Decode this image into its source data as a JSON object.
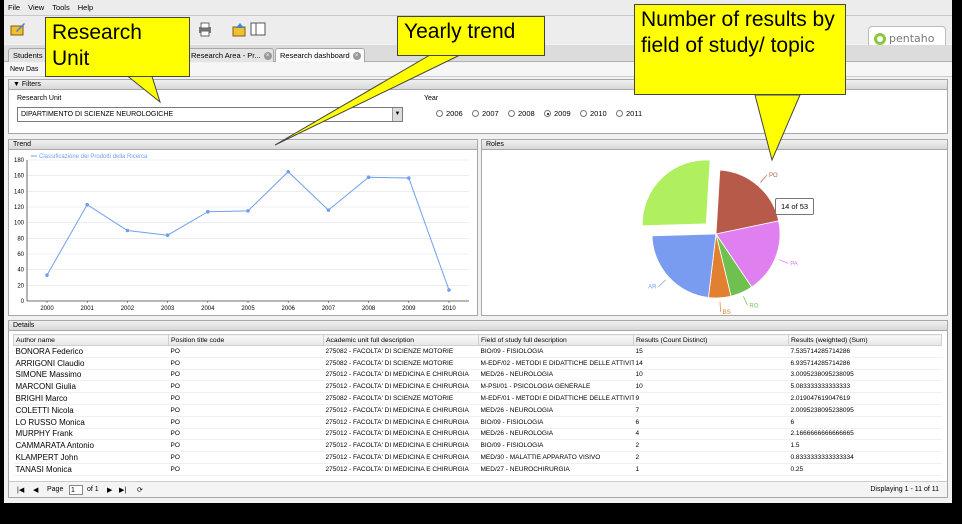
{
  "menu": {
    "items": [
      "File",
      "View",
      "Tools",
      "Help"
    ]
  },
  "logo_text": "pentaho",
  "tabs": [
    {
      "label": "Students"
    },
    {
      "label": "Research Area - Pr..."
    },
    {
      "label": "Research dashboard"
    }
  ],
  "subbar_label": "New Das",
  "filters": {
    "title": "Filters",
    "research_unit_label": "Research Unit",
    "research_unit_value": "DIPARTIMENTO DI SCIENZE NEUROLOGICHE",
    "year_label": "Year",
    "years": [
      "2006",
      "2007",
      "2008",
      "2009",
      "2010",
      "2011"
    ],
    "selected_year": "2009"
  },
  "trend_title": "Trend",
  "roles_title": "Roles",
  "details_title": "Details",
  "tooltip": "14 of 53",
  "callouts": {
    "research_unit": "Research Unit",
    "yearly_trend": "Yearly trend",
    "results_by_field": "Number of results by field of study/ topic"
  },
  "chart_data": [
    {
      "type": "line",
      "legend": "Classificazione dei Prodotti della Ricerca",
      "x": [
        "2000",
        "2001",
        "2002",
        "2003",
        "2004",
        "2005",
        "2006",
        "2007",
        "2008",
        "2009",
        "2010"
      ],
      "series": [
        {
          "name": "Classificazione dei Prodotti della Ricerca",
          "values": [
            33,
            123,
            90,
            84,
            114,
            115,
            165,
            116,
            158,
            157,
            14
          ]
        }
      ],
      "ylim": [
        0,
        180
      ],
      "yticks": [
        0,
        20,
        40,
        60,
        80,
        100,
        120,
        140,
        160,
        180
      ],
      "color": "#6f9ff0",
      "grid": true,
      "legend_position": "top-left"
    },
    {
      "type": "pie",
      "categories": [
        "PO",
        "PA",
        "RO",
        "BS",
        "AR",
        "RU"
      ],
      "values": [
        11,
        10,
        3,
        3,
        12,
        14
      ],
      "exploded": "RU",
      "colors": [
        "#b85a4a",
        "#e080f0",
        "#70c050",
        "#e08030",
        "#7a9cf0",
        "#b0f060"
      ],
      "labels_shown": [
        "PO",
        "PA",
        "RO",
        "BS",
        "AR"
      ]
    }
  ],
  "details": {
    "columns": [
      "Author name",
      "Position title code",
      "Academic unit full description",
      "Field of study full description",
      "Results (Count Distinct)",
      "Results (weighted) (Sum)"
    ],
    "rows": [
      [
        "BONORA Federico",
        "PO",
        "275082 - FACOLTA' DI SCIENZE MOTORIE",
        "BIO/09 - FISIOLOGIA",
        "15",
        "7.535714285714286"
      ],
      [
        "ARRIGONI Claudio",
        "PO",
        "275082 - FACOLTA' DI SCIENZE MOTORIE",
        "M-EDF/02 - METODI E DIDATTICHE DELLE ATTIVITA' SP",
        "14",
        "6.935714285714286"
      ],
      [
        "SIMONE Massimo",
        "PO",
        "275012 - FACOLTA' DI MEDICINA E CHIRURGIA",
        "MED/26 - NEUROLOGIA",
        "10",
        "3.0095238095238095"
      ],
      [
        "MARCONI Giulia",
        "PO",
        "275012 - FACOLTA' DI MEDICINA E CHIRURGIA",
        "M-PSI/01 - PSICOLOGIA GENERALE",
        "10",
        "5.083333333333333"
      ],
      [
        "BRIGHI Marco",
        "PO",
        "275082 - FACOLTA' DI SCIENZE MOTORIE",
        "M-EDF/01 - METODI E DIDATTICHE DELLE ATTIVITA' MC",
        "9",
        "2.019047619047619"
      ],
      [
        "COLETTI Nicola",
        "PO",
        "275012 - FACOLTA' DI MEDICINA E CHIRURGIA",
        "MED/26 - NEUROLOGIA",
        "7",
        "2.0095238095238095"
      ],
      [
        "LO RUSSO Monica",
        "PO",
        "275012 - FACOLTA' DI MEDICINA E CHIRURGIA",
        "BIO/09 - FISIOLOGIA",
        "6",
        "6"
      ],
      [
        "MURPHY Frank",
        "PO",
        "275012 - FACOLTA' DI MEDICINA E CHIRURGIA",
        "MED/26 - NEUROLOGIA",
        "4",
        "2.1666666666666665"
      ],
      [
        "CAMMARATA Antonio",
        "PO",
        "275012 - FACOLTA' DI MEDICINA E CHIRURGIA",
        "BIO/09 - FISIOLOGIA",
        "2",
        "1.5"
      ],
      [
        "KLAMPERT John",
        "PO",
        "275012 - FACOLTA' DI MEDICINA E CHIRURGIA",
        "MED/30 - MALATTIE APPARATO VISIVO",
        "2",
        "0.8333333333333334"
      ],
      [
        "TANASI Monica",
        "PO",
        "275012 - FACOLTA' DI MEDICINA E CHIRURGIA",
        "MED/27 - NEUROCHIRURGIA",
        "1",
        "0.25"
      ]
    ]
  },
  "pager": {
    "page_label": "Page",
    "page_value": "1",
    "of_label": "of 1",
    "display_text": "Displaying 1 - 11 of 11"
  }
}
